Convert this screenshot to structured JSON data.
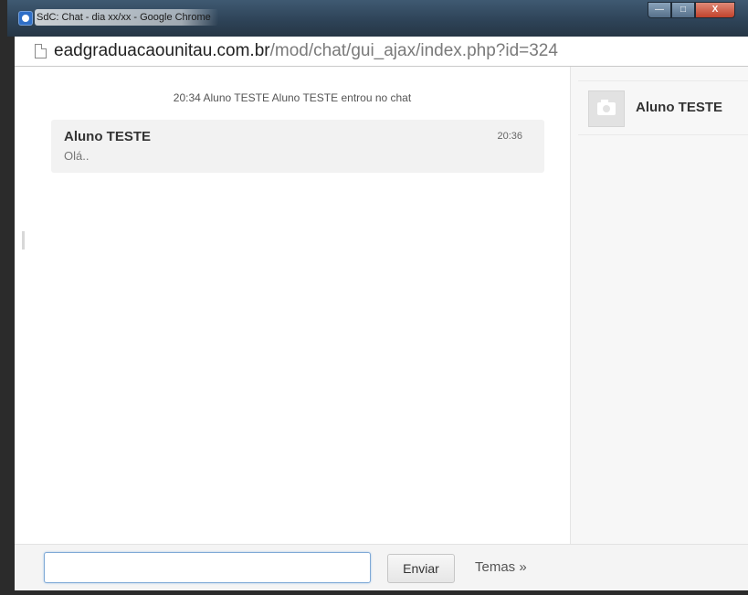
{
  "window": {
    "title": "SdC: Chat - dia xx/xx - Google Chrome",
    "controls": {
      "minimize": "—",
      "maximize": "□",
      "close": "X"
    }
  },
  "address_bar": {
    "host": "eadgraduacaounitau.com.br",
    "path": "/mod/chat/gui_ajax/index.php?id=324"
  },
  "chat": {
    "system_message": "20:34 Aluno TESTE Aluno TESTE entrou no chat",
    "messages": [
      {
        "author": "Aluno TESTE",
        "time": "20:36",
        "text": "Olá.."
      }
    ]
  },
  "users": [
    {
      "name": "Aluno TESTE",
      "avatar": "camera-placeholder-icon"
    }
  ],
  "composer": {
    "input_value": "",
    "input_placeholder": "",
    "send_label": "Enviar",
    "themes_label": "Temas »"
  },
  "colors": {
    "titlebar": "#2d4256",
    "input_focus_border": "#7fa9d6",
    "message_card": "#f2f2f2",
    "users_panel": "#f7f7f7"
  }
}
